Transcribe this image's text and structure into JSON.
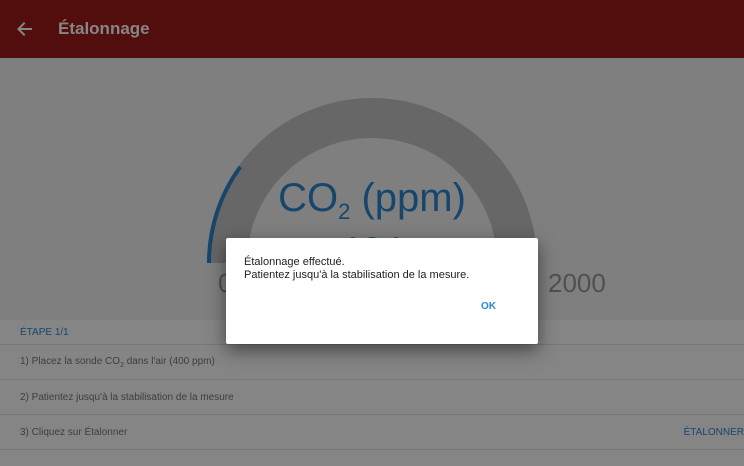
{
  "appbar": {
    "title": "Étalonnage",
    "back_icon": "arrow-left-icon"
  },
  "gauge": {
    "title_main": "CO",
    "title_sub": "2",
    "title_unit": " (ppm)",
    "value": "401",
    "min_label": "0",
    "max_label": "2000",
    "min": 0,
    "max": 2000,
    "current": 401,
    "track_color": "#c6c6c6",
    "fill_color": "#2d86d2"
  },
  "steps": {
    "header": "ÉTAPE 1/1",
    "items": [
      {
        "label_pre": "1) Placez la sonde CO",
        "label_sub": "2",
        "label_post": " dans l'air (400 ppm)"
      },
      {
        "label": "2) Patientez jusqu'à la stabilisation de la mesure"
      },
      {
        "label": "3) Cliquez sur Étalonner",
        "action": "ÉTALONNER"
      }
    ]
  },
  "dialog": {
    "line1": "Étalonnage effectué.",
    "line2": "Patientez jusqu'à la stabilisation de la mesure.",
    "ok_label": "OK"
  },
  "colors": {
    "appbar": "#9b1c19",
    "accent": "#2d86d2"
  }
}
